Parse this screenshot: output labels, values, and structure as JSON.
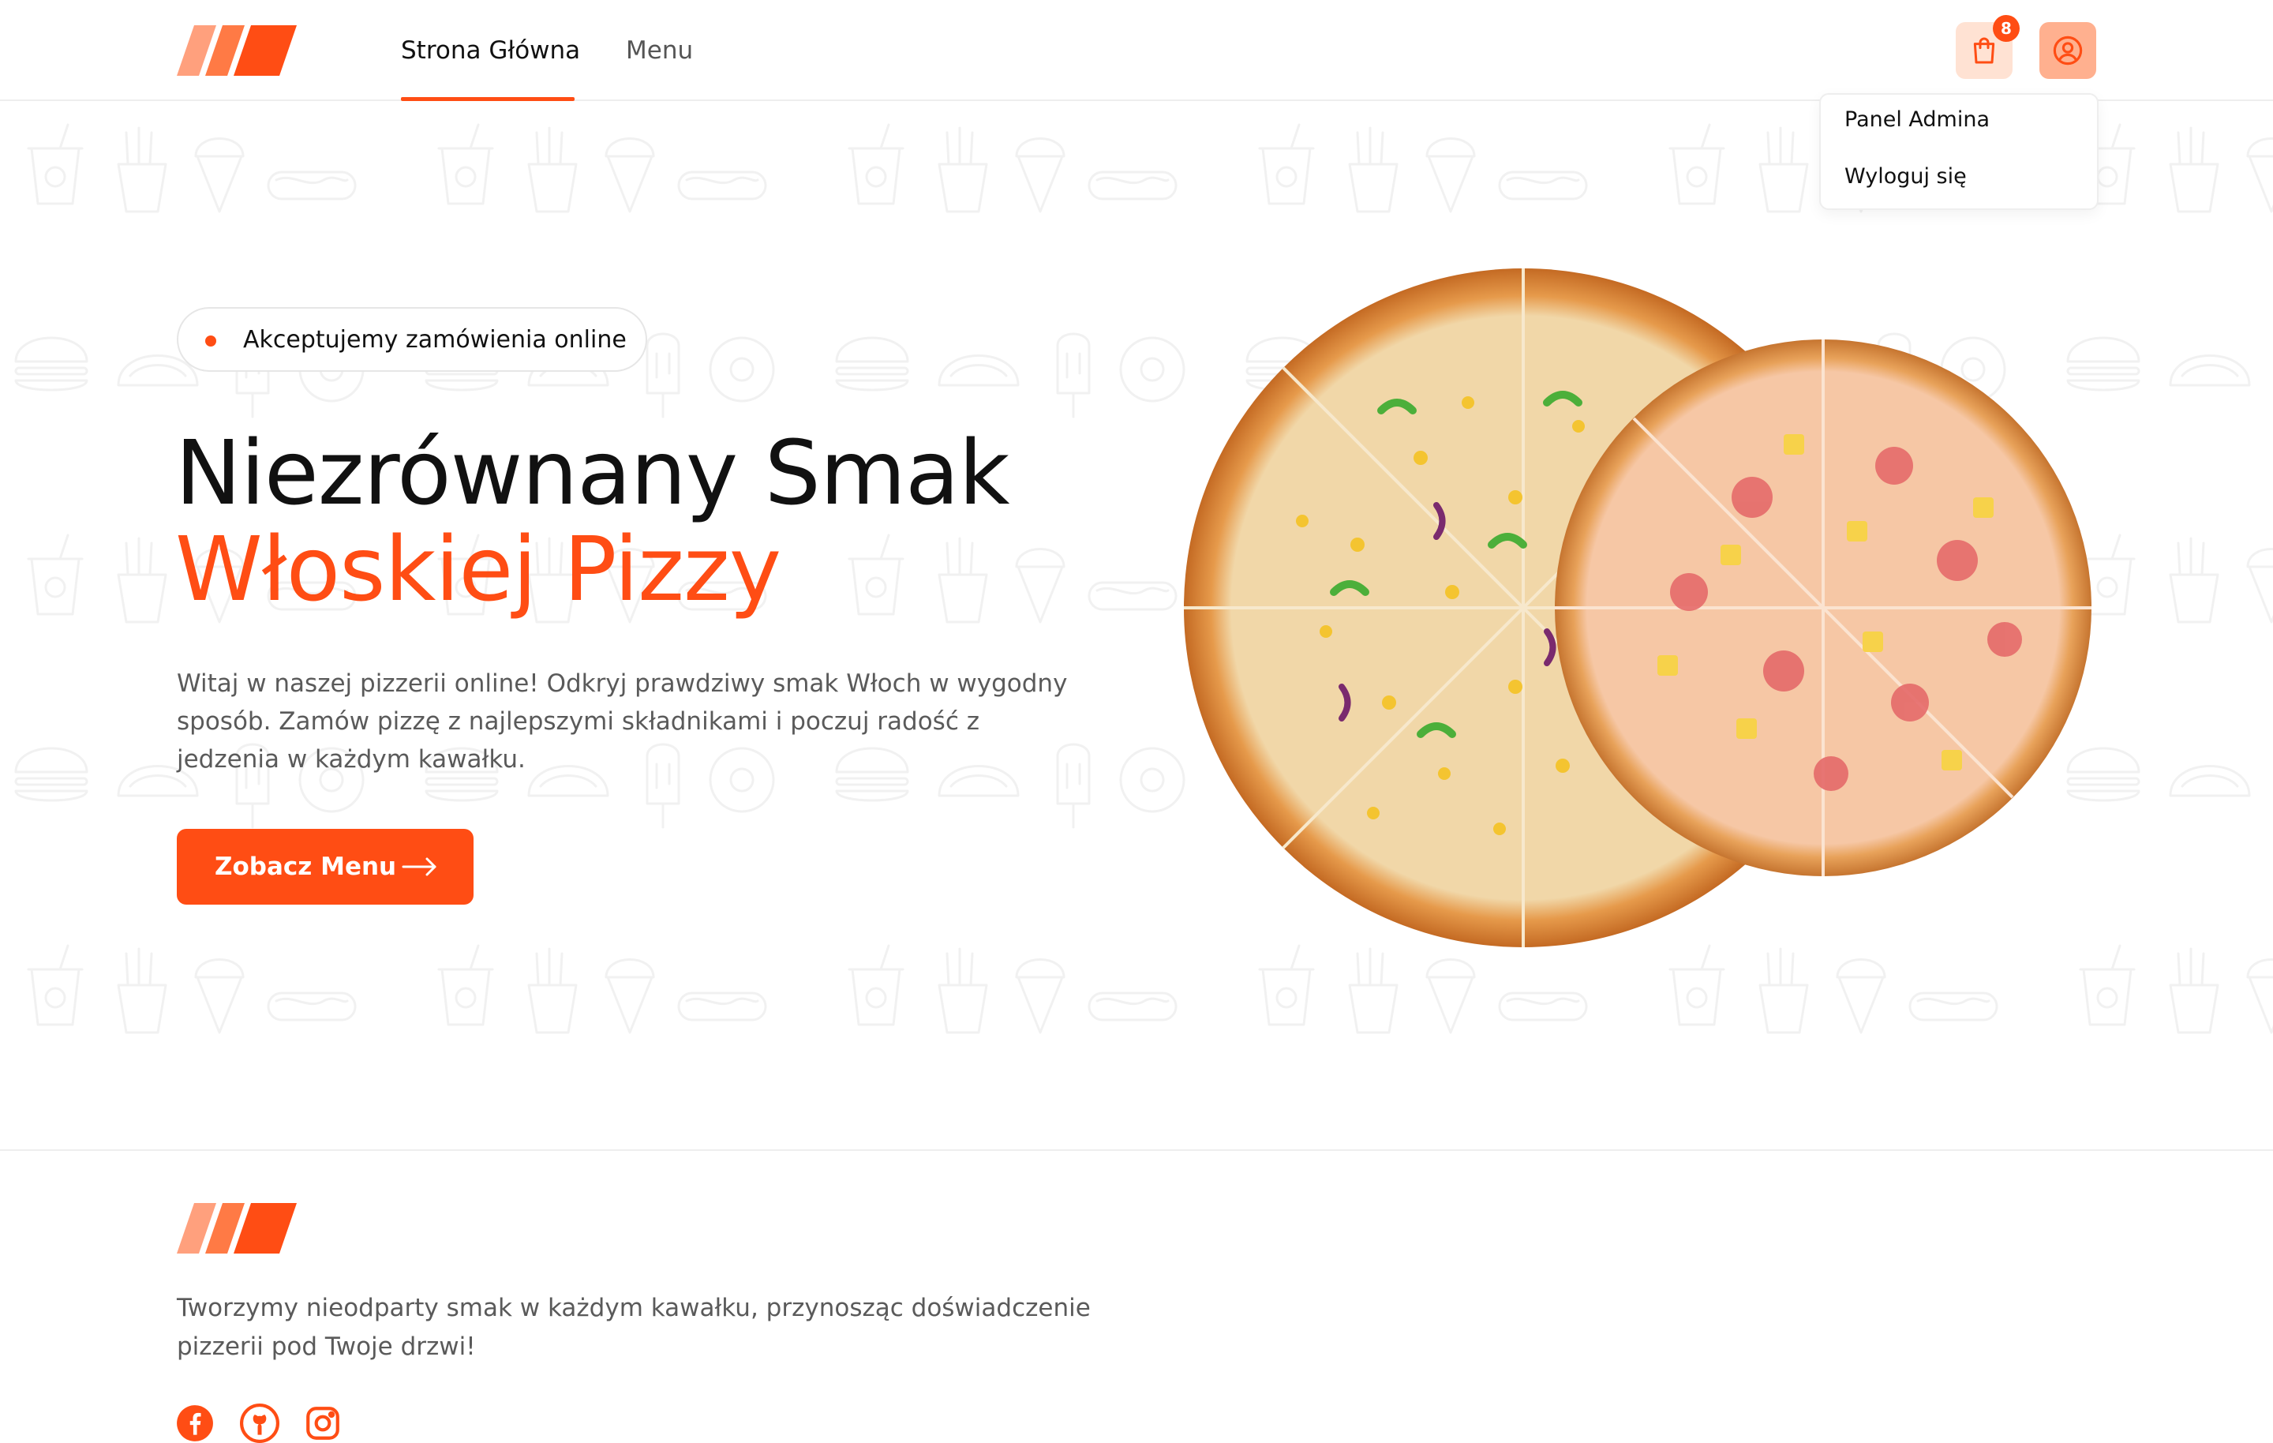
{
  "header": {
    "nav": [
      {
        "label": "Strona Główna",
        "active": true
      },
      {
        "label": "Menu",
        "active": false
      }
    ],
    "cart_count": "8",
    "dropdown": {
      "items": [
        "Panel Admina",
        "Wyloguj się"
      ]
    }
  },
  "hero": {
    "pill_text": "Akceptujemy zamówienia online",
    "title_line1": "Niezrównany Smak",
    "title_line2": "Włoskiej Pizzy",
    "description": "Witaj w naszej pizzerii online! Odkryj prawdziwy smak Włoch w wygodny sposób. Zamów pizzę z najlepszymi składnikami i poczuj radość z jedzenia w każdym kawałku.",
    "cta_label": "Zobacz Menu"
  },
  "footer": {
    "description": "Tworzymy nieodparty smak w każdym kawałku, przynosząc doświadczenie pizzerii pod Twoje drzwi!",
    "social": [
      "facebook-icon",
      "github-icon",
      "instagram-icon"
    ]
  },
  "colors": {
    "accent": "#ff4d14",
    "accent_light": "#ffb08f",
    "accent_pale": "#ffe2d3",
    "text_primary": "#111111",
    "text_secondary": "#5a5a5a"
  }
}
